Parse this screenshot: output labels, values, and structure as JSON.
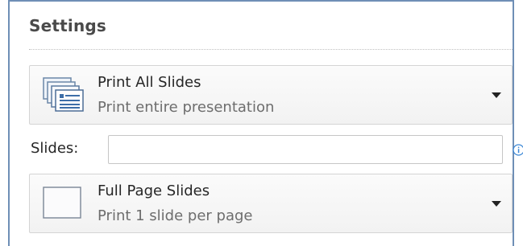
{
  "settings": {
    "title": "Settings"
  },
  "print_range": {
    "title": "Print All Slides",
    "subtitle": "Print entire presentation",
    "icon": "slides-stack-icon"
  },
  "slides_field": {
    "label": "Slides:",
    "value": "",
    "placeholder": "",
    "info_icon": "info-icon"
  },
  "layout": {
    "title": "Full Page Slides",
    "subtitle": "Print 1 slide per page",
    "icon": "full-page-slide-icon"
  },
  "colors": {
    "frame_border": "#6f8fb6",
    "info_icon": "#3a87d6"
  }
}
